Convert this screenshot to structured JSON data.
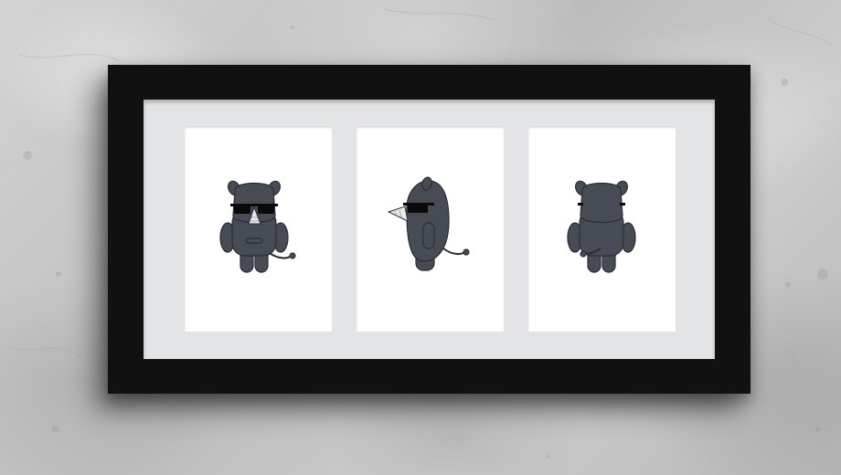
{
  "scene": {
    "description_icon": "framed-rhino-triptych",
    "colors": {
      "wall": "#c4c4c4",
      "frame": "#111111",
      "mat": "#e3e4e6",
      "print_paper": "#ffffff",
      "rhino_body": "#474b55",
      "rhino_outline": "#2a2d33",
      "sunglasses": "#0a0a0a",
      "horn": "#e9e9e9"
    }
  },
  "prints": [
    {
      "view": "front",
      "icon": "rhino-front-icon"
    },
    {
      "view": "side",
      "icon": "rhino-side-icon"
    },
    {
      "view": "back",
      "icon": "rhino-back-icon"
    }
  ]
}
